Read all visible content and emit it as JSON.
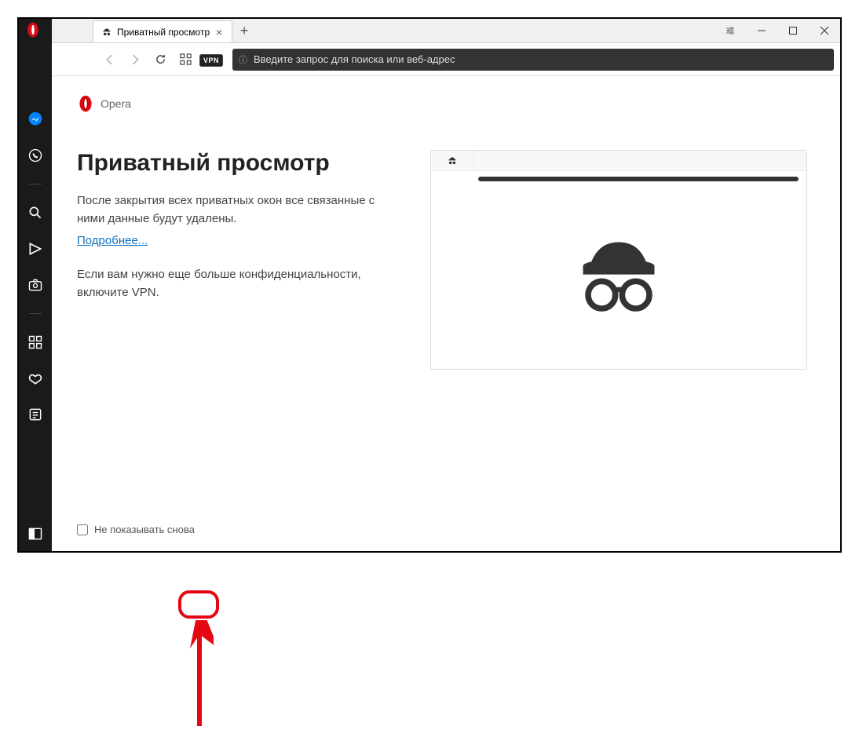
{
  "window": {
    "tab_title": "Приватный просмотр"
  },
  "toolbar": {
    "vpn_label": "VPN",
    "address_placeholder": "Введите запрос для поиска или веб-адрес"
  },
  "brand": {
    "name": "Opera"
  },
  "page": {
    "heading": "Приватный просмотр",
    "description": "После закрытия всех приватных окон все связанные с ними данные будут удалены.",
    "more_link": "Подробнее...",
    "vpn_hint": "Если вам нужно еще больше конфиденциальности, включите VPN.",
    "dont_show_label": "Не показывать снова"
  }
}
